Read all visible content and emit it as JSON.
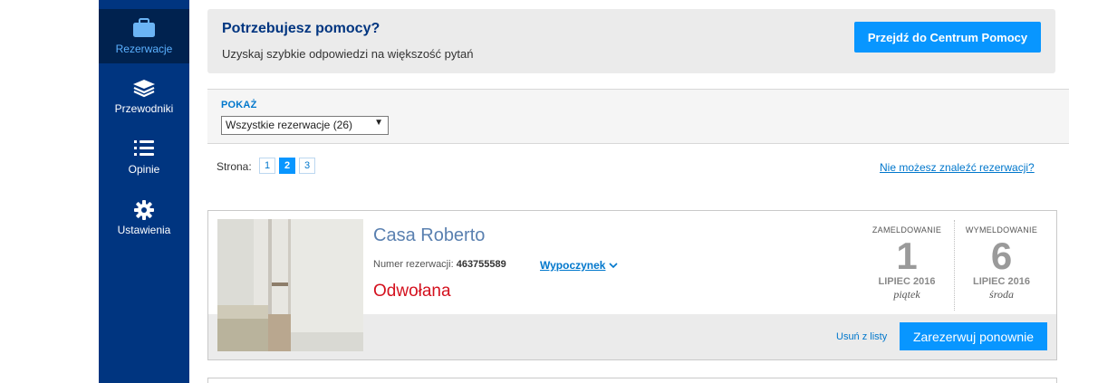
{
  "sidebar": {
    "items": [
      {
        "label": "Rezerwacje",
        "icon": "suitcase-icon",
        "active": true
      },
      {
        "label": "Przewodniki",
        "icon": "guides-stack-icon",
        "active": false
      },
      {
        "label": "Opinie",
        "icon": "reviews-list-icon",
        "active": false
      },
      {
        "label": "Ustawienia",
        "icon": "gear-icon",
        "active": false
      }
    ],
    "colors": {
      "background": "#003580",
      "active_background": "#00224f"
    }
  },
  "help": {
    "title": "Potrzebujesz pomocy?",
    "subtitle": "Uzyskaj szybkie odpowiedzi na większość pytań",
    "button_label": "Przejdź do Centrum Pomocy"
  },
  "filter": {
    "label": "POKAŻ",
    "selected": "Wszystkie rezerwacje (26)"
  },
  "pagination": {
    "label": "Strona:",
    "pages": [
      "1",
      "2",
      "3"
    ],
    "current": "2",
    "cant_find_link": "Nie możesz znaleźć rezerwacji?"
  },
  "booking": {
    "hotel_name": "Casa Roberto",
    "booking_number_label": "Numer rezerwacji:",
    "booking_number": "463755589",
    "trip_type": "Wypoczynek",
    "status": "Odwołana",
    "checkin": {
      "label": "ZAMELDOWANIE",
      "day": "1",
      "month": "LIPIEC 2016",
      "weekday": "piątek"
    },
    "checkout": {
      "label": "WYMELDOWANIE",
      "day": "6",
      "month": "LIPIEC 2016",
      "weekday": "środa"
    },
    "remove_label": "Usuń z listy",
    "rebook_label": "Zarezerwuj ponownie"
  },
  "colors": {
    "accent": "#0896ff",
    "link": "#0077cc",
    "cancelled": "#d4111e"
  }
}
